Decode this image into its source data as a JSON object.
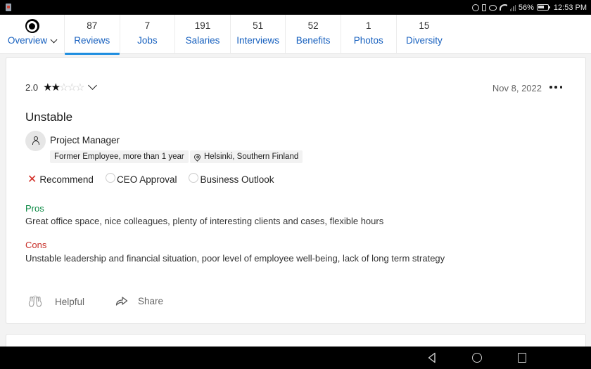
{
  "status_bar": {
    "battery": "56%",
    "time": "12:53 PM"
  },
  "tabs": [
    {
      "count": "",
      "label": "Overview",
      "active": false
    },
    {
      "count": "87",
      "label": "Reviews",
      "active": true
    },
    {
      "count": "7",
      "label": "Jobs",
      "active": false
    },
    {
      "count": "191",
      "label": "Salaries",
      "active": false
    },
    {
      "count": "51",
      "label": "Interviews",
      "active": false
    },
    {
      "count": "52",
      "label": "Benefits",
      "active": false
    },
    {
      "count": "1",
      "label": "Photos",
      "active": false
    },
    {
      "count": "15",
      "label": "Diversity",
      "active": false
    }
  ],
  "review": {
    "rating": "2.0",
    "stars_filled": 2,
    "stars_total": 5,
    "date": "Nov 8, 2022",
    "title": "Unstable",
    "job_title": "Project Manager",
    "employment": "Former Employee, more than 1 year",
    "location": "Helsinki, Southern Finland",
    "verdicts": {
      "recommend": "Recommend",
      "ceo_approval": "CEO Approval",
      "business_outlook": "Business Outlook"
    },
    "pros_label": "Pros",
    "pros_text": "Great office space, nice colleagues, plenty of interesting clients and cases, flexible hours",
    "cons_label": "Cons",
    "cons_text": "Unstable leadership and financial situation, poor level of employee well-being, lack of long term strategy",
    "helpful_label": "Helpful",
    "share_label": "Share"
  },
  "colors": {
    "tab_label": "#1861bf",
    "tab_active_underline": "#1e8ee0",
    "pros": "#0c8a45",
    "cons": "#c8302a",
    "not_recommend": "#d22d25"
  }
}
